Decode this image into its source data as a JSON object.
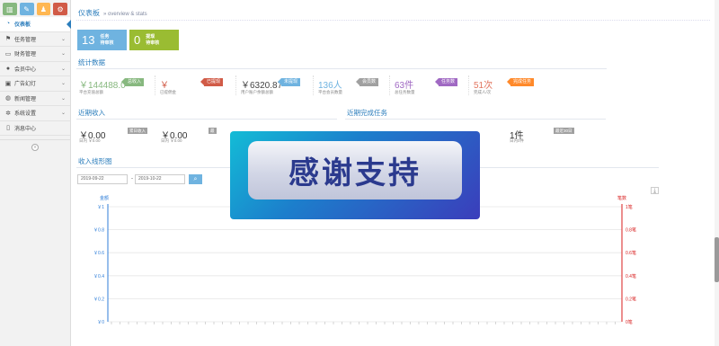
{
  "sidebar": {
    "shortcuts": [
      {
        "icon": "chart-icon",
        "glyph": "▥",
        "color": "#87b87f"
      },
      {
        "icon": "pencil-icon",
        "glyph": "✎",
        "color": "#6fb3e0"
      },
      {
        "icon": "users-icon",
        "glyph": "♟",
        "color": "#ffb752"
      },
      {
        "icon": "cogs-icon",
        "glyph": "⚙",
        "color": "#d15b47"
      }
    ],
    "items": [
      {
        "label": "仪表板",
        "icon": "tachometer-icon",
        "glyph": "◔",
        "active": true,
        "has_children": false
      },
      {
        "label": "任务管理",
        "icon": "flag-icon",
        "glyph": "⚑",
        "active": false,
        "has_children": true
      },
      {
        "label": "财务管理",
        "icon": "hdd-icon",
        "glyph": "▭",
        "active": false,
        "has_children": true
      },
      {
        "label": "会员中心",
        "icon": "user-icon",
        "glyph": "●",
        "active": false,
        "has_children": true
      },
      {
        "label": "广告幻灯",
        "icon": "film-icon",
        "glyph": "▣",
        "active": false,
        "has_children": true
      },
      {
        "label": "新闻管理",
        "icon": "globe-icon",
        "glyph": "◍",
        "active": false,
        "has_children": true
      },
      {
        "label": "系统设置",
        "icon": "gear-icon",
        "glyph": "✲",
        "active": false,
        "has_children": true
      },
      {
        "label": "消息中心",
        "icon": "bookmark-icon",
        "glyph": "▯",
        "active": false,
        "has_children": false
      }
    ],
    "collapse_glyph": "«"
  },
  "header": {
    "title": "仪表板",
    "subtitle": "» overview & stats"
  },
  "tiles": [
    {
      "value": "13",
      "line1": "任务",
      "line2": "待审核",
      "color": "#6fb3e0"
    },
    {
      "value": "0",
      "line1": "提现",
      "line2": "待审核",
      "color": "#9abc32"
    }
  ],
  "stats": {
    "title": "统计数据",
    "items": [
      {
        "value": "￥144488.0",
        "sub": "平台充值总额",
        "badge": "总收入",
        "value_color": "#87b87f",
        "badge_color": "#87b87f"
      },
      {
        "value": "￥",
        "sub": "已提佣金",
        "badge": "已提现",
        "value_color": "#d15b47",
        "badge_color": "#d15b47"
      },
      {
        "value": "￥6320.87",
        "sub": "用户账户余额总额",
        "badge": "未提现",
        "value_color": "#444444",
        "badge_color": "#6fb3e0"
      },
      {
        "value": "136人",
        "sub": "平台会员数量",
        "badge": "会员数",
        "value_color": "#6fb3e0",
        "badge_color": "#a0a0a0"
      },
      {
        "value": "63件",
        "sub": "总任务数量",
        "badge": "任务数",
        "value_color": "#a069c3",
        "badge_color": "#a069c3"
      },
      {
        "value": "51次",
        "sub": "完成人/次",
        "badge": "完成任务",
        "value_color": "#e2755f",
        "badge_color": "#ff892a"
      }
    ]
  },
  "recent_income": {
    "title": "近期收入",
    "items": [
      {
        "value": "￥0.00",
        "sub": "日内 ￥0.00",
        "tag": "累日收入"
      },
      {
        "value": "￥0.00",
        "sub": "日内 ￥0.00",
        "tag": "最"
      }
    ]
  },
  "recent_tasks": {
    "title": "近期完成任务",
    "items": [
      {
        "value": "1件",
        "sub": "日内0件",
        "tag": "最近30日"
      }
    ]
  },
  "income_chart": {
    "section_title": "收入线形图",
    "date_from": "2019-09-22",
    "date_to": "2019-10-22",
    "range_sep": "-",
    "search_glyph": "⌕",
    "download_glyph": "⤓"
  },
  "chart_data": {
    "type": "line",
    "left_axis_label": "金额",
    "right_axis_label": "笔数",
    "left_ticks": [
      "￥0",
      "￥0.2",
      "￥0.4",
      "￥0.6",
      "￥0.8",
      "￥1"
    ],
    "right_ticks": [
      "0笔",
      "0.2笔",
      "0.4笔",
      "0.6笔",
      "0.8笔",
      "1笔"
    ],
    "left_color": "#2f7ed8",
    "right_color": "#d81e1e",
    "ylim": [
      0,
      1
    ],
    "series": [],
    "grid": true
  },
  "banner": {
    "text": "感谢支持"
  }
}
